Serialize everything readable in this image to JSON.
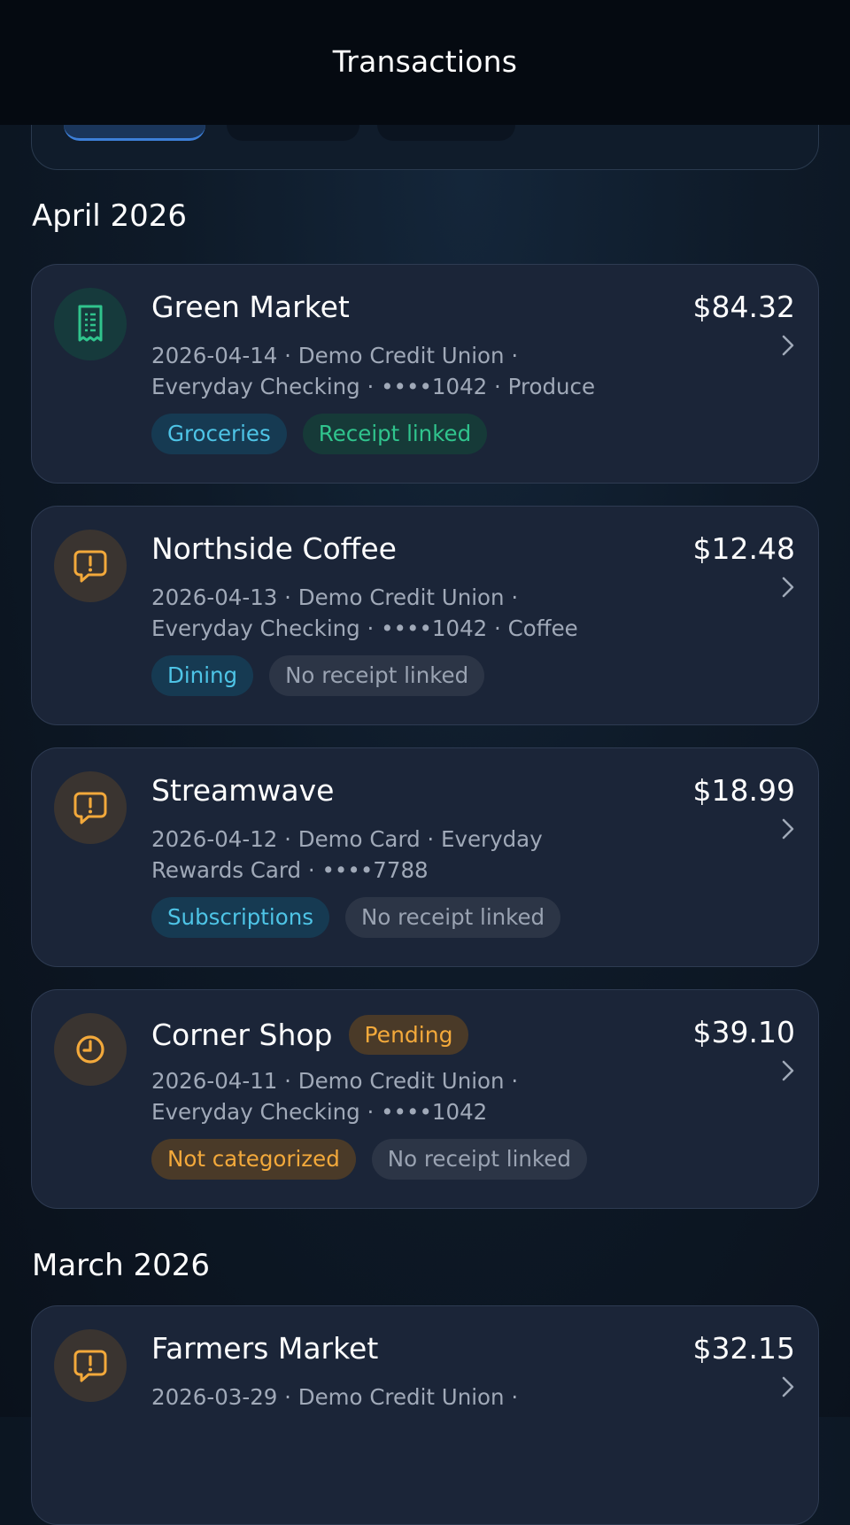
{
  "header": {
    "title": "Transactions"
  },
  "sections": [
    {
      "title": "April 2026",
      "transactions": [
        {
          "merchant": "Green Market",
          "amount": "$84.32",
          "icon": "receipt-icon",
          "details_line1": "2026-04-14 · Demo Credit Union ·",
          "details_line2": "Everyday Checking · ••••1042 · Produce",
          "category": "Groceries",
          "receipt": "Receipt linked"
        },
        {
          "merchant": "Northside Coffee",
          "amount": "$12.48",
          "icon": "alert-message-icon",
          "details_line1": "2026-04-13 · Demo Credit Union ·",
          "details_line2": "Everyday Checking · ••••1042 · Coffee",
          "category": "Dining",
          "receipt": "No receipt linked"
        },
        {
          "merchant": "Streamwave",
          "amount": "$18.99",
          "icon": "alert-message-icon",
          "details_line1": "2026-04-12 · Demo Card · Everyday",
          "details_line2": "Rewards Card · ••••7788",
          "category": "Subscriptions",
          "receipt": "No receipt linked"
        },
        {
          "merchant": "Corner Shop",
          "status": "Pending",
          "amount": "$39.10",
          "icon": "clock-icon",
          "details_line1": "2026-04-11 · Demo Credit Union ·",
          "details_line2": "Everyday Checking · ••••1042",
          "category": "Not categorized",
          "receipt": "No receipt linked"
        }
      ]
    },
    {
      "title": "March 2026",
      "transactions": [
        {
          "merchant": "Farmers Market",
          "amount": "$32.15",
          "icon": "alert-message-icon",
          "details_line1": "2026-03-29 · Demo Credit Union ·"
        }
      ]
    }
  ],
  "colors": {
    "accent_cyan": "#4ec4e6",
    "receipt_green": "#30c48d",
    "warning_amber": "#f3a93b",
    "card_background": "#1b2538"
  }
}
